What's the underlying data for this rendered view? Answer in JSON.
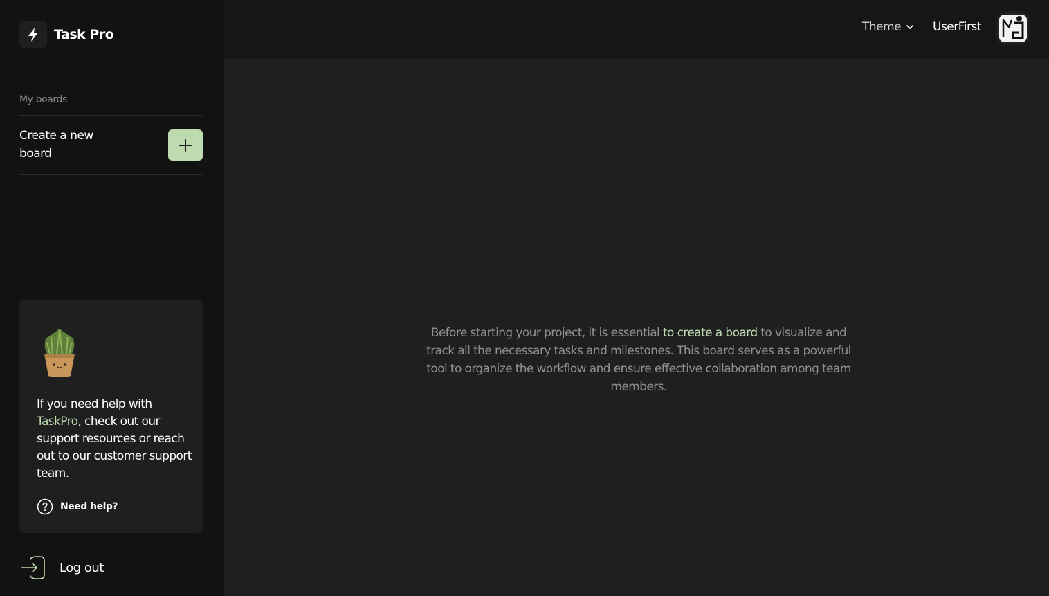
{
  "brand": {
    "title": "Task Pro",
    "icon": "lightning-icon"
  },
  "sidebar": {
    "boards_label": "My boards",
    "create_board_text": "Create a new board",
    "add_icon": "plus-icon",
    "help": {
      "text_before": "If you need help with ",
      "text_accent": "TaskPro",
      "text_after": ", check out our support resources or reach out to our customer support team.",
      "link_label": "Need help?",
      "icon": "question-circle-icon"
    },
    "logout_label": "Log out",
    "logout_icon": "login-arrow-icon"
  },
  "header": {
    "theme_label": "Theme",
    "theme_icon": "chevron-down-icon",
    "user_name": "UserFirst"
  },
  "main": {
    "message_before": "Before starting your project, it is essential ",
    "message_link": "to create a board",
    "message_after": " to visualize and track all the necessary tasks and milestones. This board serves as a powerful tool to organize the workflow and ensure effective collaboration among team members."
  },
  "colors": {
    "accent": "#bedbb0",
    "sidebar_bg": "#121212",
    "header_bg": "#161616",
    "main_bg": "#1f1f1f"
  }
}
